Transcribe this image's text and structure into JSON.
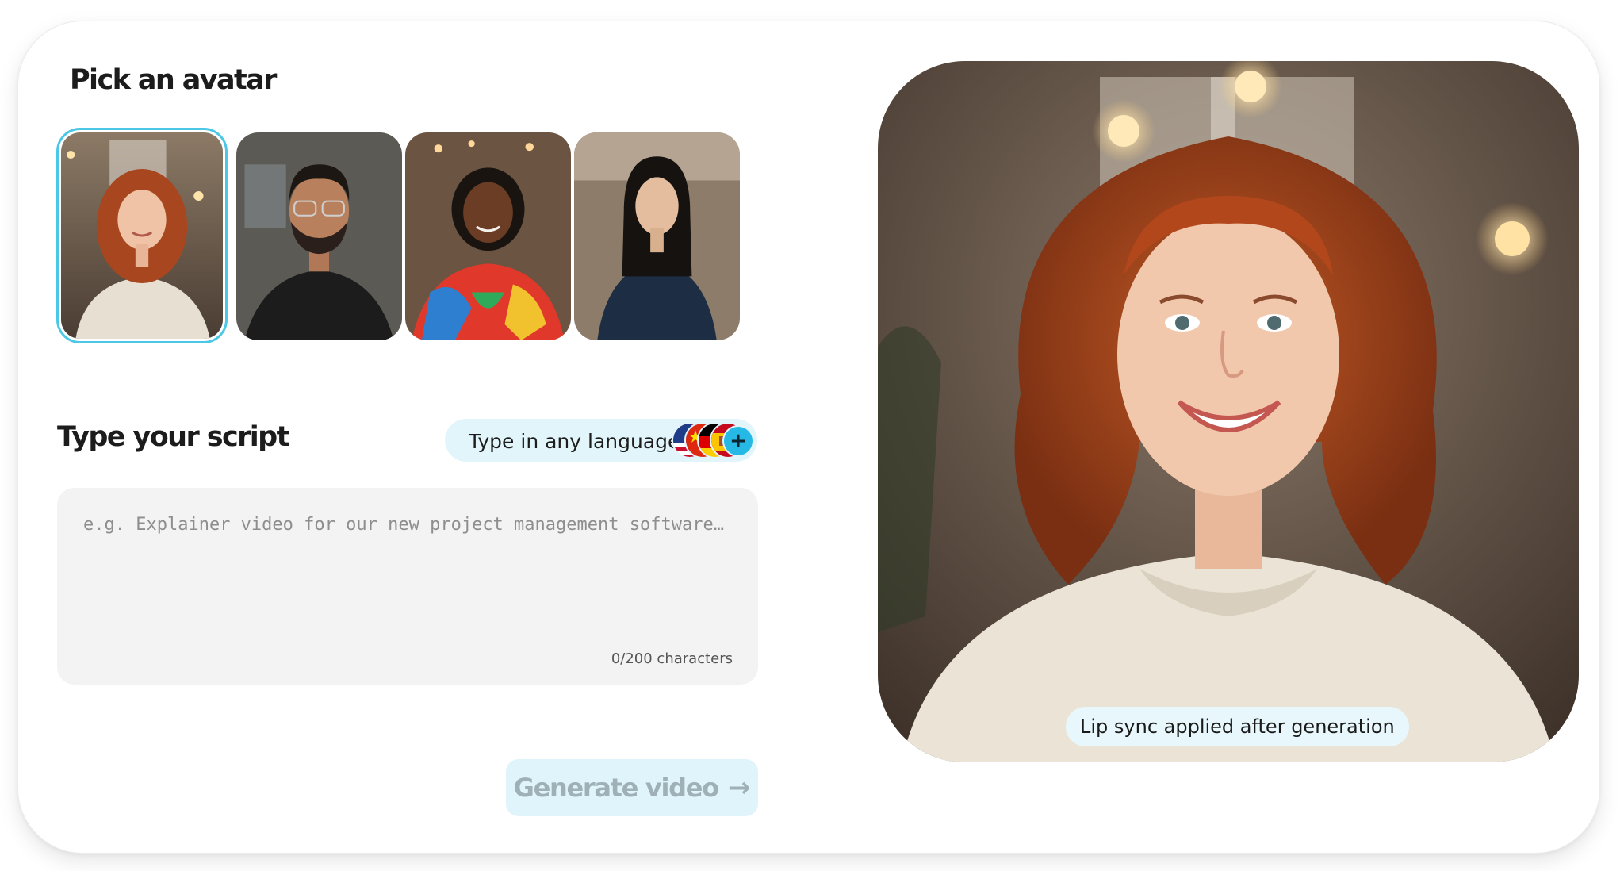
{
  "avatar_section": {
    "title": "Pick an avatar",
    "avatars": [
      {
        "name": "curly-red-hair-woman",
        "selected": true
      },
      {
        "name": "bearded-man-glasses",
        "selected": false
      },
      {
        "name": "woman-colorful-shirt",
        "selected": false
      },
      {
        "name": "woman-navy-shirt",
        "selected": false
      }
    ]
  },
  "script_section": {
    "title": "Type your script",
    "language_pill": {
      "label": "Type in any language",
      "flags": [
        "us-flag-icon",
        "china-flag-icon",
        "germany-flag-icon",
        "spain-flag-icon"
      ],
      "more_icon": "+"
    },
    "input": {
      "value": "",
      "placeholder": "e.g. Explainer video for our new project management software…"
    },
    "char_count": "0/200 characters"
  },
  "generate_button": {
    "label": "Generate video",
    "arrow": "→"
  },
  "preview": {
    "badge": "Lip sync applied after generation"
  },
  "colors": {
    "accent": "#27b9e6",
    "selected_border": "#4cc8e6",
    "pill_bg": "#e1f5fb",
    "input_bg": "#f3f3f3",
    "button_bg_disabled": "#dff4fb",
    "button_text_disabled": "#9fb0b6"
  }
}
